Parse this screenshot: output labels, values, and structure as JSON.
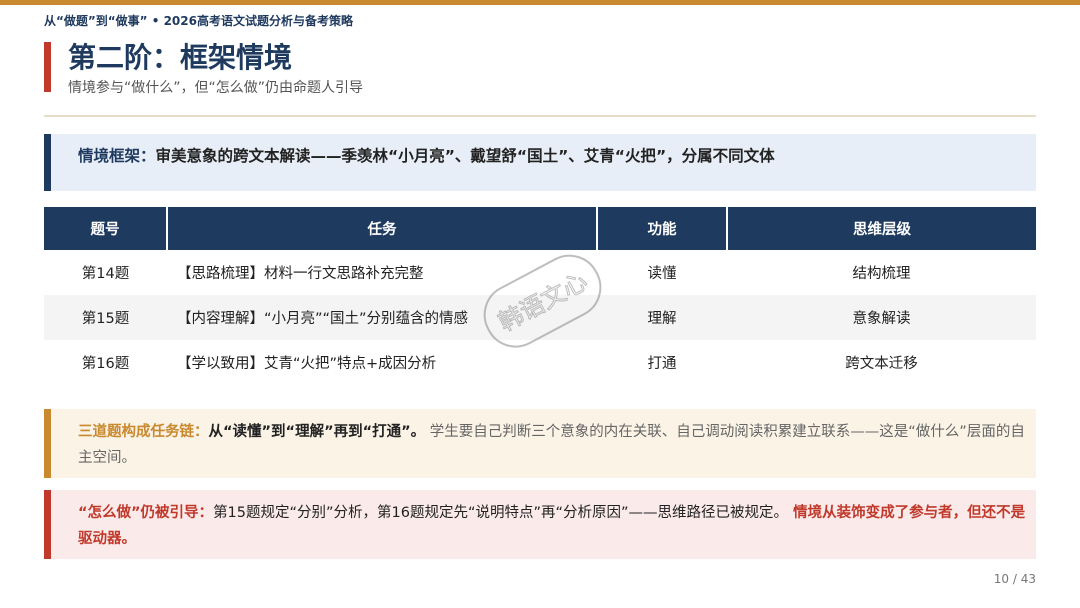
{
  "header": {
    "text": "从“做题”到“做事” • 2026高考语文试题分析与备考策略"
  },
  "title": "第二阶：框架情境",
  "subtitle": "情境参与“做什么”，但“怎么做”仍由命题人引导",
  "framework": {
    "label": "情境框架：",
    "text": "审美意象的跨文本解读——季羡林“小月亮”、戴望舒“国土”、艾青“火把”，分属不同文体"
  },
  "table": {
    "headers": [
      "题号",
      "任务",
      "功能",
      "思维层级"
    ],
    "rows": [
      [
        "第14题",
        "【思路梳理】材料一行文思路补充完整",
        "读懂",
        "结构梳理"
      ],
      [
        "第15题",
        "【内容理解】“小月亮”“国土”分别蕴含的情感",
        "理解",
        "意象解读"
      ],
      [
        "第16题",
        "【学以致用】艾青“火把”特点+成因分析",
        "打通",
        "跨文本迁移"
      ]
    ]
  },
  "chain": {
    "lead": "三道题构成任务链：",
    "strong": "从“读懂”到“理解”再到“打通”。",
    "text": " 学生要自己判断三个意象的内在关联、自己调动阅读积累建立联系——这是“做什么”层面的自主空间。"
  },
  "guide": {
    "lead": "“怎么做”仍被引导：",
    "text": "第15题规定“分别”分析，第16题规定先“说明特点”再“分析原因”——思维路径已被规定。",
    "tail": " 情境从装饰变成了参与者，但还不是驱动器。"
  },
  "watermark": {
    "text": "韩语文心"
  },
  "page_number": "10 / 43",
  "colors": {
    "navy": "#1f3a5f",
    "gold": "#c9892e",
    "red": "#c0392b"
  }
}
